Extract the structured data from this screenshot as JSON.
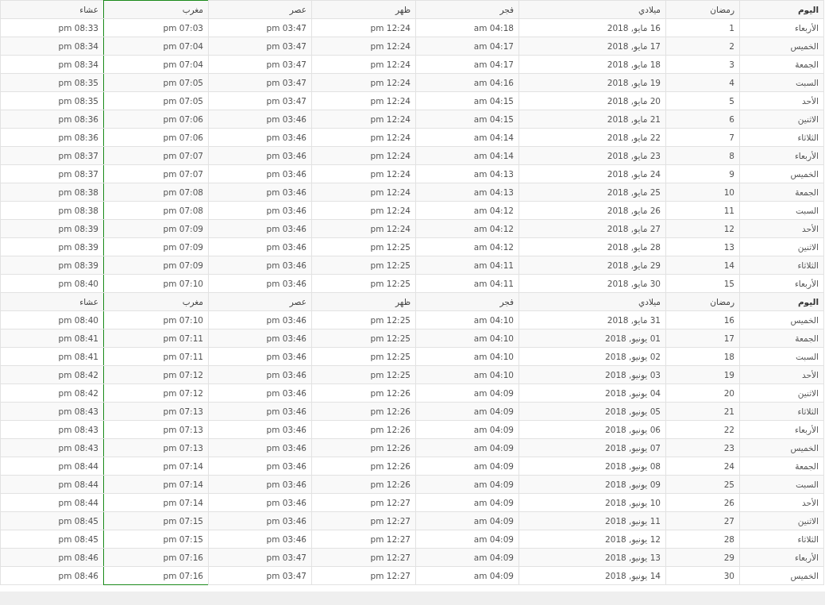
{
  "sections": [
    {
      "columns": [
        {
          "label": "اليوم",
          "highlighted": false
        },
        {
          "label": "رمضان",
          "highlighted": false
        },
        {
          "label": "ميلادي",
          "highlighted": false
        },
        {
          "label": "فجر",
          "highlighted": false
        },
        {
          "label": "ظهر",
          "highlighted": false
        },
        {
          "label": "عصر",
          "highlighted": false
        },
        {
          "label": "مغرب",
          "highlighted": true
        },
        {
          "label": "عشاء",
          "highlighted": false
        }
      ],
      "rows": [
        [
          "الأربعاء",
          "1",
          "16 مايو, 2018",
          "04:18 am",
          "12:24 pm",
          "03:47 pm",
          "07:03 pm",
          "08:33 pm"
        ],
        [
          "الخميس",
          "2",
          "17 مايو, 2018",
          "04:17 am",
          "12:24 pm",
          "03:47 pm",
          "07:04 pm",
          "08:34 pm"
        ],
        [
          "الجمعة",
          "3",
          "18 مايو, 2018",
          "04:17 am",
          "12:24 pm",
          "03:47 pm",
          "07:04 pm",
          "08:34 pm"
        ],
        [
          "السبت",
          "4",
          "19 مايو, 2018",
          "04:16 am",
          "12:24 pm",
          "03:47 pm",
          "07:05 pm",
          "08:35 pm"
        ],
        [
          "الأحد",
          "5",
          "20 مايو, 2018",
          "04:15 am",
          "12:24 pm",
          "03:47 pm",
          "07:05 pm",
          "08:35 pm"
        ],
        [
          "الاثنين",
          "6",
          "21 مايو, 2018",
          "04:15 am",
          "12:24 pm",
          "03:46 pm",
          "07:06 pm",
          "08:36 pm"
        ],
        [
          "الثلاثاء",
          "7",
          "22 مايو, 2018",
          "04:14 am",
          "12:24 pm",
          "03:46 pm",
          "07:06 pm",
          "08:36 pm"
        ],
        [
          "الأربعاء",
          "8",
          "23 مايو, 2018",
          "04:14 am",
          "12:24 pm",
          "03:46 pm",
          "07:07 pm",
          "08:37 pm"
        ],
        [
          "الخميس",
          "9",
          "24 مايو, 2018",
          "04:13 am",
          "12:24 pm",
          "03:46 pm",
          "07:07 pm",
          "08:37 pm"
        ],
        [
          "الجمعة",
          "10",
          "25 مايو, 2018",
          "04:13 am",
          "12:24 pm",
          "03:46 pm",
          "07:08 pm",
          "08:38 pm"
        ],
        [
          "السبت",
          "11",
          "26 مايو, 2018",
          "04:12 am",
          "12:24 pm",
          "03:46 pm",
          "07:08 pm",
          "08:38 pm"
        ],
        [
          "الأحد",
          "12",
          "27 مايو, 2018",
          "04:12 am",
          "12:24 pm",
          "03:46 pm",
          "07:09 pm",
          "08:39 pm"
        ],
        [
          "الاثنين",
          "13",
          "28 مايو, 2018",
          "04:12 am",
          "12:25 pm",
          "03:46 pm",
          "07:09 pm",
          "08:39 pm"
        ],
        [
          "الثلاثاء",
          "14",
          "29 مايو, 2018",
          "04:11 am",
          "12:25 pm",
          "03:46 pm",
          "07:09 pm",
          "08:39 pm"
        ],
        [
          "الأربعاء",
          "15",
          "30 مايو, 2018",
          "04:11 am",
          "12:25 pm",
          "03:46 pm",
          "07:10 pm",
          "08:40 pm"
        ]
      ]
    },
    {
      "columns": [
        {
          "label": "اليوم",
          "highlighted": false
        },
        {
          "label": "رمضان",
          "highlighted": false
        },
        {
          "label": "ميلادي",
          "highlighted": false
        },
        {
          "label": "فجر",
          "highlighted": false
        },
        {
          "label": "ظهر",
          "highlighted": false
        },
        {
          "label": "عصر",
          "highlighted": false
        },
        {
          "label": "مغرب",
          "highlighted": true
        },
        {
          "label": "عشاء",
          "highlighted": false
        }
      ],
      "rows": [
        [
          "الخميس",
          "16",
          "31 مايو, 2018",
          "04:10 am",
          "12:25 pm",
          "03:46 pm",
          "07:10 pm",
          "08:40 pm"
        ],
        [
          "الجمعة",
          "17",
          "01 يونيو, 2018",
          "04:10 am",
          "12:25 pm",
          "03:46 pm",
          "07:11 pm",
          "08:41 pm"
        ],
        [
          "السبت",
          "18",
          "02 يونيو, 2018",
          "04:10 am",
          "12:25 pm",
          "03:46 pm",
          "07:11 pm",
          "08:41 pm"
        ],
        [
          "الأحد",
          "19",
          "03 يونيو, 2018",
          "04:10 am",
          "12:25 pm",
          "03:46 pm",
          "07:12 pm",
          "08:42 pm"
        ],
        [
          "الاثنين",
          "20",
          "04 يونيو, 2018",
          "04:09 am",
          "12:26 pm",
          "03:46 pm",
          "07:12 pm",
          "08:42 pm"
        ],
        [
          "الثلاثاء",
          "21",
          "05 يونيو, 2018",
          "04:09 am",
          "12:26 pm",
          "03:46 pm",
          "07:13 pm",
          "08:43 pm"
        ],
        [
          "الأربعاء",
          "22",
          "06 يونيو, 2018",
          "04:09 am",
          "12:26 pm",
          "03:46 pm",
          "07:13 pm",
          "08:43 pm"
        ],
        [
          "الخميس",
          "23",
          "07 يونيو, 2018",
          "04:09 am",
          "12:26 pm",
          "03:46 pm",
          "07:13 pm",
          "08:43 pm"
        ],
        [
          "الجمعة",
          "24",
          "08 يونيو, 2018",
          "04:09 am",
          "12:26 pm",
          "03:46 pm",
          "07:14 pm",
          "08:44 pm"
        ],
        [
          "السبت",
          "25",
          "09 يونيو, 2018",
          "04:09 am",
          "12:26 pm",
          "03:46 pm",
          "07:14 pm",
          "08:44 pm"
        ],
        [
          "الأحد",
          "26",
          "10 يونيو, 2018",
          "04:09 am",
          "12:27 pm",
          "03:46 pm",
          "07:14 pm",
          "08:44 pm"
        ],
        [
          "الاثنين",
          "27",
          "11 يونيو, 2018",
          "04:09 am",
          "12:27 pm",
          "03:46 pm",
          "07:15 pm",
          "08:45 pm"
        ],
        [
          "الثلاثاء",
          "28",
          "12 يونيو, 2018",
          "04:09 am",
          "12:27 pm",
          "03:46 pm",
          "07:15 pm",
          "08:45 pm"
        ],
        [
          "الأربعاء",
          "29",
          "13 يونيو, 2018",
          "04:09 am",
          "12:27 pm",
          "03:47 pm",
          "07:16 pm",
          "08:46 pm"
        ],
        [
          "الخميس",
          "30",
          "14 يونيو, 2018",
          "04:09 am",
          "12:27 pm",
          "03:47 pm",
          "07:16 pm",
          "08:46 pm"
        ]
      ]
    }
  ]
}
